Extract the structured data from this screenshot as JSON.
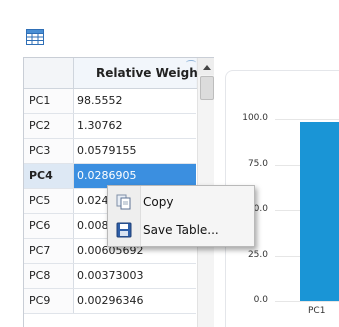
{
  "toolbar": {
    "table_icon": "table-icon"
  },
  "table": {
    "column_header": "Relative Weigh",
    "rows": [
      {
        "label": "PC1",
        "value": "98.5552"
      },
      {
        "label": "PC2",
        "value": "1.30762"
      },
      {
        "label": "PC3",
        "value": "0.0579155"
      },
      {
        "label": "PC4",
        "value": "0.0286905"
      },
      {
        "label": "PC5",
        "value": "0.024"
      },
      {
        "label": "PC6",
        "value": "0.008"
      },
      {
        "label": "PC7",
        "value": "0.00605692"
      },
      {
        "label": "PC8",
        "value": "0.00373003"
      },
      {
        "label": "PC9",
        "value": "0.00296346"
      }
    ],
    "selected_row": "PC4"
  },
  "context_menu": {
    "items": [
      {
        "label": "Copy",
        "icon": "copy-icon"
      },
      {
        "label": "Save Table...",
        "icon": "save-icon"
      }
    ]
  },
  "chart_data": {
    "type": "bar",
    "categories": [
      "PC1"
    ],
    "values": [
      98.5552
    ],
    "ylim": [
      0,
      100
    ],
    "yticks": [
      "100.0",
      "75.0",
      "50.0",
      "25.0",
      "0.0"
    ],
    "xticks": [
      "PC1"
    ],
    "grid": true,
    "bar_color": "#1a95d6"
  },
  "colors": {
    "selection": "#3b8fe0",
    "bar": "#1a95d6"
  }
}
